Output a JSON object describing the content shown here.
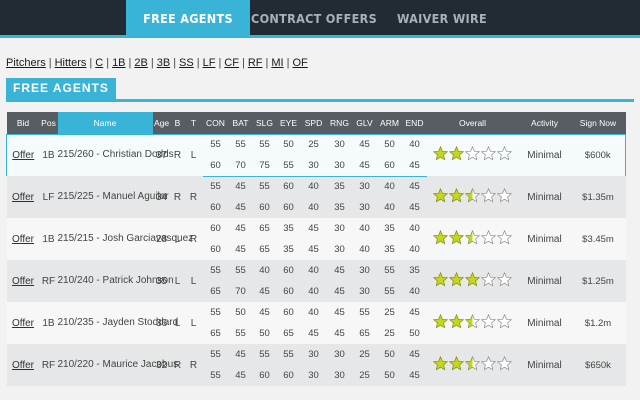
{
  "tabs": [
    {
      "label": "Free Agents",
      "active": true
    },
    {
      "label": "Contract Offers",
      "active": false
    },
    {
      "label": "Waiver Wire",
      "active": false
    }
  ],
  "filters": [
    "Pitchers",
    "Hitters",
    "C",
    "1B",
    "2B",
    "3B",
    "SS",
    "LF",
    "CF",
    "RF",
    "MI",
    "OF"
  ],
  "section_title": "Free Agents",
  "columns": [
    "Bid",
    "Pos",
    "Name",
    "Age",
    "B",
    "T",
    "CON",
    "BAT",
    "SLG",
    "EYE",
    "SPD",
    "RNG",
    "GLV",
    "ARM",
    "END",
    "Overall",
    "Activity",
    "Sign Now"
  ],
  "colors": {
    "accent": "#3ab4d6",
    "header_bg": "#575d63",
    "nav_bg": "#222a33",
    "star_fill": "#c3d81b",
    "star_empty": "#b0b0b0"
  },
  "players": [
    {
      "offer": "Offer",
      "pos": "1B",
      "name": "215/260 - Christian Dodds",
      "age": "37",
      "b": "R",
      "t": "L",
      "row1": [
        "55",
        "55",
        "55",
        "50",
        "25",
        "30",
        "45",
        "50",
        "40"
      ],
      "row2": [
        "60",
        "70",
        "75",
        "55",
        "30",
        "30",
        "45",
        "60",
        "45"
      ],
      "rating": 2,
      "activity": "Minimal",
      "cost": "$600k",
      "selected": true
    },
    {
      "offer": "Offer",
      "pos": "LF",
      "name": "215/225 - Manuel Aguilar",
      "age": "34",
      "b": "R",
      "t": "R",
      "row1": [
        "55",
        "45",
        "55",
        "60",
        "40",
        "35",
        "30",
        "40",
        "45"
      ],
      "row2": [
        "60",
        "45",
        "60",
        "60",
        "40",
        "35",
        "30",
        "40",
        "45"
      ],
      "rating": 2.5,
      "activity": "Minimal",
      "cost": "$1.35m",
      "selected": false
    },
    {
      "offer": "Offer",
      "pos": "1B",
      "name": "215/215 - Josh Garciavasquez",
      "age": "28",
      "b": "L",
      "t": "R",
      "row1": [
        "60",
        "45",
        "65",
        "35",
        "45",
        "30",
        "40",
        "35",
        "40"
      ],
      "row2": [
        "60",
        "45",
        "65",
        "35",
        "45",
        "30",
        "40",
        "35",
        "40"
      ],
      "rating": 2.5,
      "activity": "Minimal",
      "cost": "$3.45m",
      "selected": false
    },
    {
      "offer": "Offer",
      "pos": "RF",
      "name": "210/240 - Patrick Johnson",
      "age": "35",
      "b": "L",
      "t": "L",
      "row1": [
        "55",
        "55",
        "40",
        "60",
        "40",
        "45",
        "30",
        "55",
        "35"
      ],
      "row2": [
        "65",
        "70",
        "45",
        "60",
        "40",
        "45",
        "30",
        "55",
        "40"
      ],
      "rating": 3,
      "activity": "Minimal",
      "cost": "$1.25m",
      "selected": false
    },
    {
      "offer": "Offer",
      "pos": "1B",
      "name": "210/235 - Jayden Stoddard",
      "age": "36",
      "b": "L",
      "t": "L",
      "row1": [
        "55",
        "50",
        "45",
        "60",
        "40",
        "45",
        "55",
        "25",
        "45"
      ],
      "row2": [
        "65",
        "55",
        "50",
        "65",
        "45",
        "45",
        "65",
        "25",
        "50"
      ],
      "rating": 2.5,
      "activity": "Minimal",
      "cost": "$1.2m",
      "selected": false
    },
    {
      "offer": "Offer",
      "pos": "RF",
      "name": "210/220 - Maurice Jacobus",
      "age": "32",
      "b": "R",
      "t": "R",
      "row1": [
        "55",
        "45",
        "55",
        "55",
        "30",
        "30",
        "25",
        "50",
        "45"
      ],
      "row2": [
        "55",
        "45",
        "60",
        "60",
        "30",
        "30",
        "25",
        "50",
        "45"
      ],
      "rating": 2.5,
      "activity": "Minimal",
      "cost": "$650k",
      "selected": false
    }
  ]
}
